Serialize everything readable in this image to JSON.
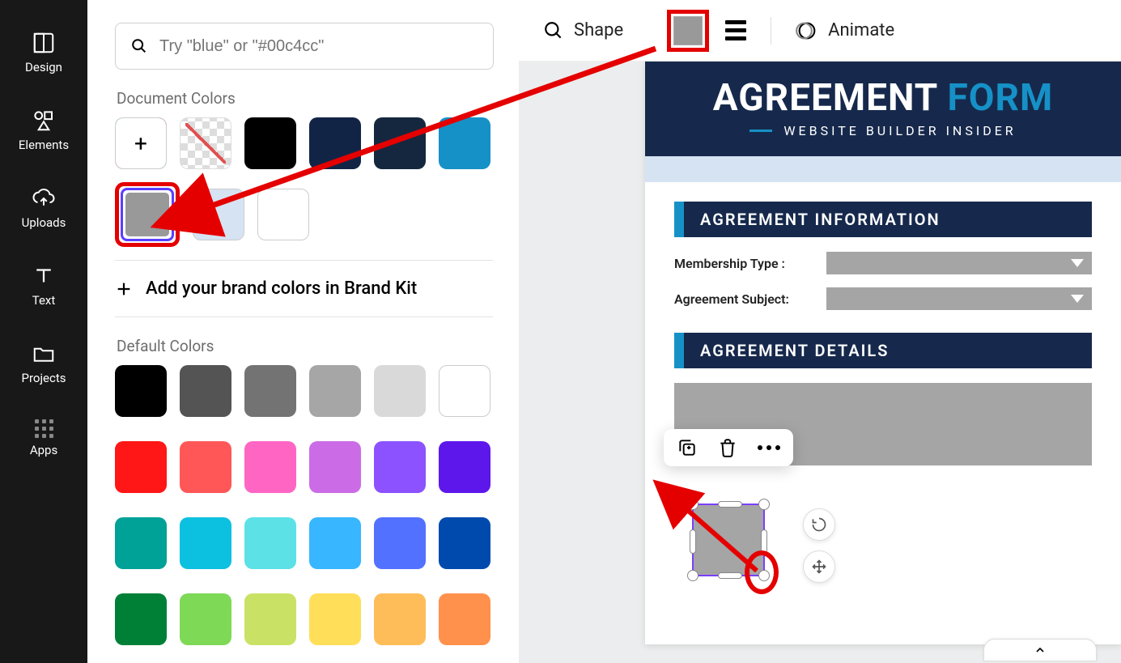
{
  "nav": {
    "design": "Design",
    "elements": "Elements",
    "uploads": "Uploads",
    "text": "Text",
    "projects": "Projects",
    "apps": "Apps"
  },
  "search": {
    "placeholder": "Try \"blue\" or \"#00c4cc\""
  },
  "sections": {
    "document_colors": "Document Colors",
    "default_colors": "Default Colors",
    "brand_kit": "Add your brand colors in Brand Kit"
  },
  "document_colors": {
    "row1": [
      "add",
      "transparent",
      "#000000",
      "#122446",
      "#15273e",
      "#1691c7"
    ],
    "row2": [
      "selected-gray",
      "#d6e3f3",
      "#ffffff"
    ]
  },
  "default_colors": [
    [
      "#000000",
      "#545454",
      "#737373",
      "#a6a6a6",
      "#d9d9d9",
      "#ffffff"
    ],
    [
      "#ff1616",
      "#ff5757",
      "#ff66c4",
      "#cb6ce6",
      "#8c52ff",
      "#5e17eb"
    ],
    [
      "#00a196",
      "#0cc0df",
      "#5ce1e6",
      "#38b6ff",
      "#5271ff",
      "#004aad"
    ],
    [
      "#008037",
      "#7ed957",
      "#c9e265",
      "#ffde59",
      "#ffbd59",
      "#ff914d"
    ]
  ],
  "toolbar": {
    "shape": "Shape",
    "animate": "Animate"
  },
  "doc": {
    "title_a": "AGREEMENT",
    "title_b": "FORM",
    "subtitle": "WEBSITE BUILDER INSIDER",
    "sect1": "AGREEMENT INFORMATION",
    "sect2": "AGREEMENT DETAILS",
    "field1": "Membership Type :",
    "field2": "Agreement Subject:"
  }
}
